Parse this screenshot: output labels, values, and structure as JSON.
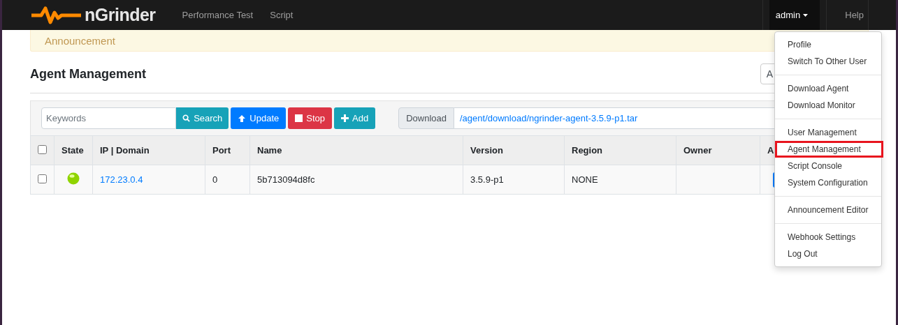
{
  "navbar": {
    "logo_text": "nGrinder",
    "links": [
      {
        "label": "Performance Test"
      },
      {
        "label": "Script"
      }
    ],
    "user_menu": {
      "label": "admin",
      "expanded": true
    },
    "help": "Help"
  },
  "announcement": "Announcement",
  "page_title": "Agent Management",
  "title_button": "A",
  "toolbar": {
    "search": {
      "placeholder": "Keywords"
    },
    "buttons": [
      {
        "kind": "search",
        "label": "Search"
      },
      {
        "kind": "update",
        "label": "Update"
      },
      {
        "kind": "stop",
        "label": "Stop"
      },
      {
        "kind": "add",
        "label": "Add"
      }
    ],
    "download": {
      "label": "Download",
      "link": "/agent/download/ngrinder-agent-3.5.9-p1.tar"
    }
  },
  "table": {
    "select_all": {
      "checked": false
    },
    "columns": [
      "State",
      "IP | Domain",
      "Port",
      "Name",
      "Version",
      "Region",
      "Owner",
      "A"
    ],
    "rows": [
      {
        "checked": false,
        "color": "#8fd400",
        "ip": "172.23.0.4",
        "port": "0",
        "name": "5b713094d8fc",
        "version": "3.5.9-p1",
        "region": "NONE",
        "owner": ""
      }
    ]
  },
  "user_dropdown": {
    "groups": [
      [
        {
          "label": "Profile",
          "highlighted": false
        },
        {
          "label": "Switch To Other User",
          "highlighted": false
        }
      ],
      [
        {
          "label": "Download Agent",
          "highlighted": false
        },
        {
          "label": "Download Monitor",
          "highlighted": false
        }
      ],
      [
        {
          "label": "User Management",
          "highlighted": false
        },
        {
          "label": "Agent Management",
          "highlighted": true
        },
        {
          "label": "Script Console",
          "highlighted": false
        },
        {
          "label": "System Configuration",
          "highlighted": false
        }
      ],
      [
        {
          "label": "Announcement Editor",
          "highlighted": false
        }
      ],
      [
        {
          "label": "Webhook Settings",
          "highlighted": false
        },
        {
          "label": "Log Out",
          "highlighted": false
        }
      ]
    ]
  }
}
